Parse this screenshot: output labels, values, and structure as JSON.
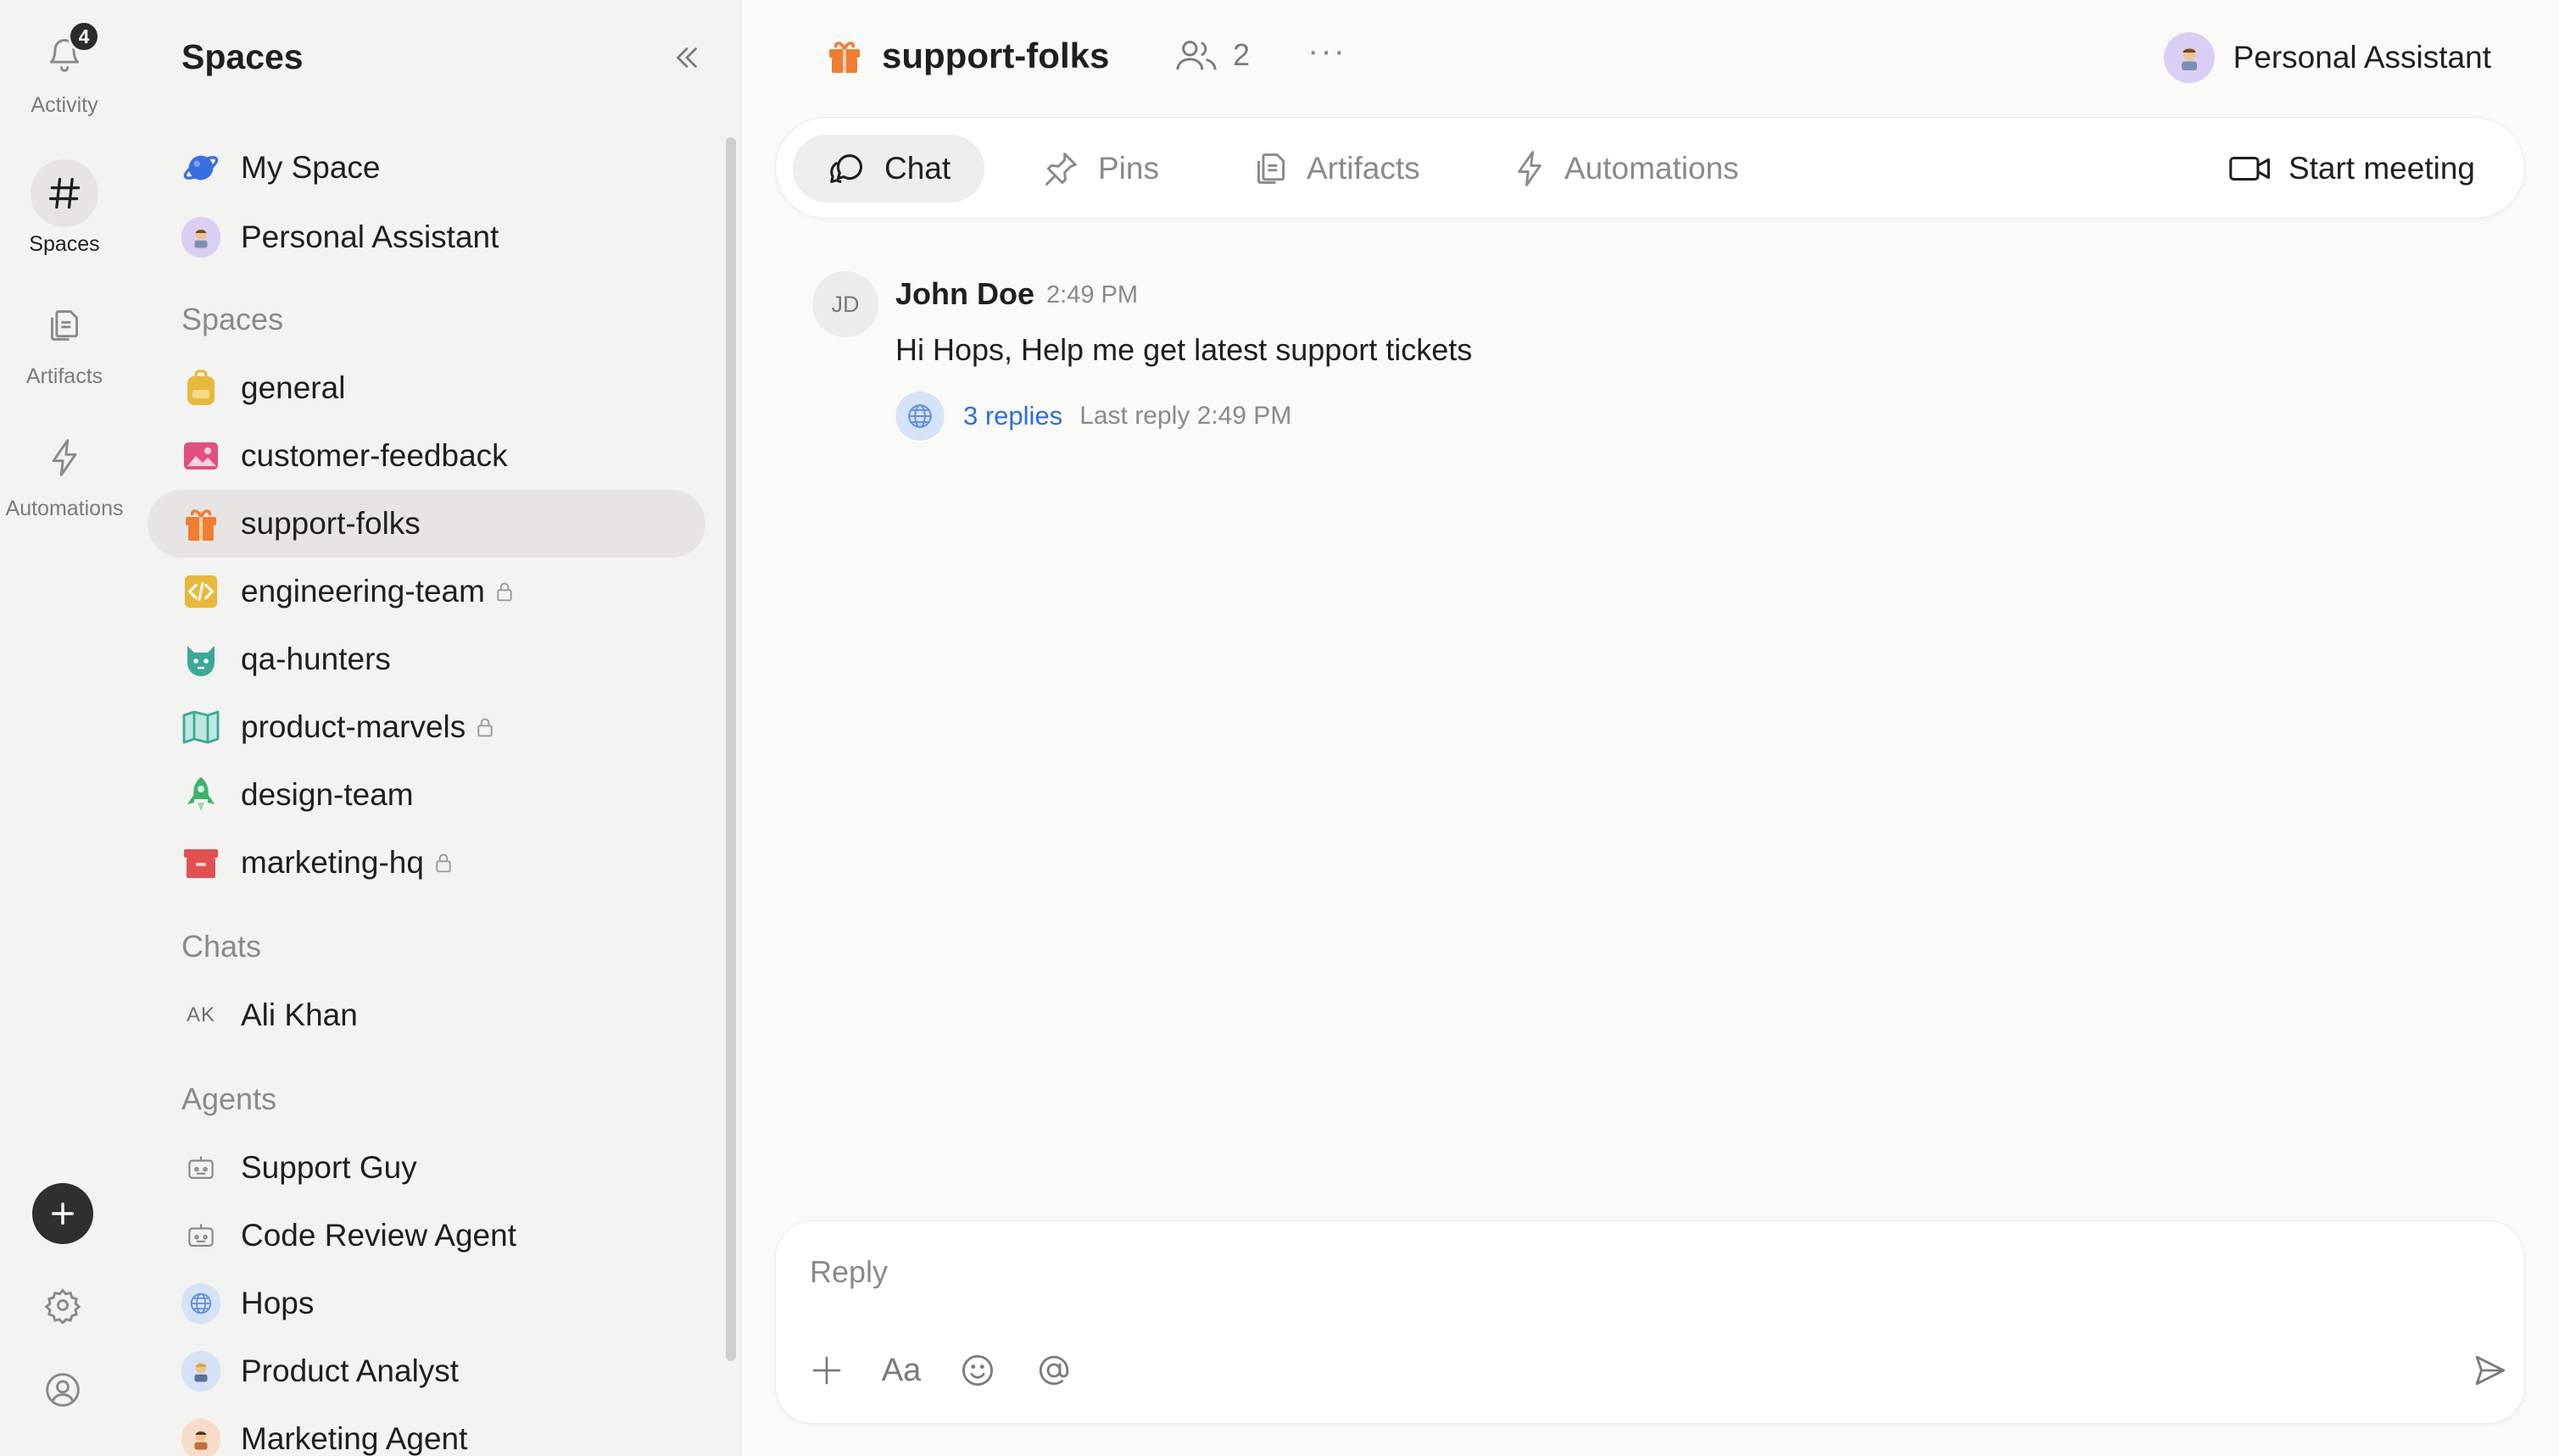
{
  "rail": {
    "activity": {
      "label": "Activity",
      "badge": "4"
    },
    "spaces": {
      "label": "Spaces"
    },
    "artifacts": {
      "label": "Artifacts"
    },
    "automations": {
      "label": "Automations"
    }
  },
  "sidebar": {
    "title": "Spaces",
    "pinned": [
      {
        "label": "My Space",
        "icon": "planet-icon"
      },
      {
        "label": "Personal Assistant",
        "icon": "assistant-avatar"
      }
    ],
    "spaces_header": "Spaces",
    "spaces": [
      {
        "label": "general",
        "icon": "backpack-icon",
        "color": "#e8b93a",
        "locked": false
      },
      {
        "label": "customer-feedback",
        "icon": "image-icon",
        "color": "#e0507f",
        "locked": false
      },
      {
        "label": "support-folks",
        "icon": "gift-icon",
        "color": "#ef7d32",
        "locked": false,
        "active": true
      },
      {
        "label": "engineering-team",
        "icon": "code-icon",
        "color": "#e8b93a",
        "locked": true
      },
      {
        "label": "qa-hunters",
        "icon": "cat-icon",
        "color": "#3aa996",
        "locked": false
      },
      {
        "label": "product-marvels",
        "icon": "map-icon",
        "color": "#3aa996",
        "locked": true
      },
      {
        "label": "design-team",
        "icon": "rocket-icon",
        "color": "#3bb36a",
        "locked": false
      },
      {
        "label": "marketing-hq",
        "icon": "archive-icon",
        "color": "#e05252",
        "locked": true
      }
    ],
    "chats_header": "Chats",
    "chats": [
      {
        "label": "Ali Khan",
        "initials": "AK"
      }
    ],
    "agents_header": "Agents",
    "agents": [
      {
        "label": "Support Guy",
        "icon": "bot-icon"
      },
      {
        "label": "Code Review Agent",
        "icon": "bot-icon"
      },
      {
        "label": "Hops",
        "icon": "globe-avatar"
      },
      {
        "label": "Product Analyst",
        "icon": "analyst-avatar"
      },
      {
        "label": "Marketing Agent",
        "icon": "marketer-avatar"
      }
    ]
  },
  "header": {
    "space_name": "support-folks",
    "members_count": "2",
    "more": "···",
    "assistant": "Personal Assistant"
  },
  "tabs": [
    {
      "label": "Chat",
      "icon": "chat-icon",
      "active": true
    },
    {
      "label": "Pins",
      "icon": "pin-icon"
    },
    {
      "label": "Artifacts",
      "icon": "files-icon"
    },
    {
      "label": "Automations",
      "icon": "bolt-icon"
    }
  ],
  "start_meeting": "Start meeting",
  "message": {
    "initials": "JD",
    "author": "John Doe",
    "time": "2:49 PM",
    "text": "Hi Hops, Help me get latest support tickets",
    "replies": "3 replies",
    "last_reply": "Last reply 2:49 PM"
  },
  "composer": {
    "placeholder": "Reply",
    "format_label": "Aa"
  }
}
